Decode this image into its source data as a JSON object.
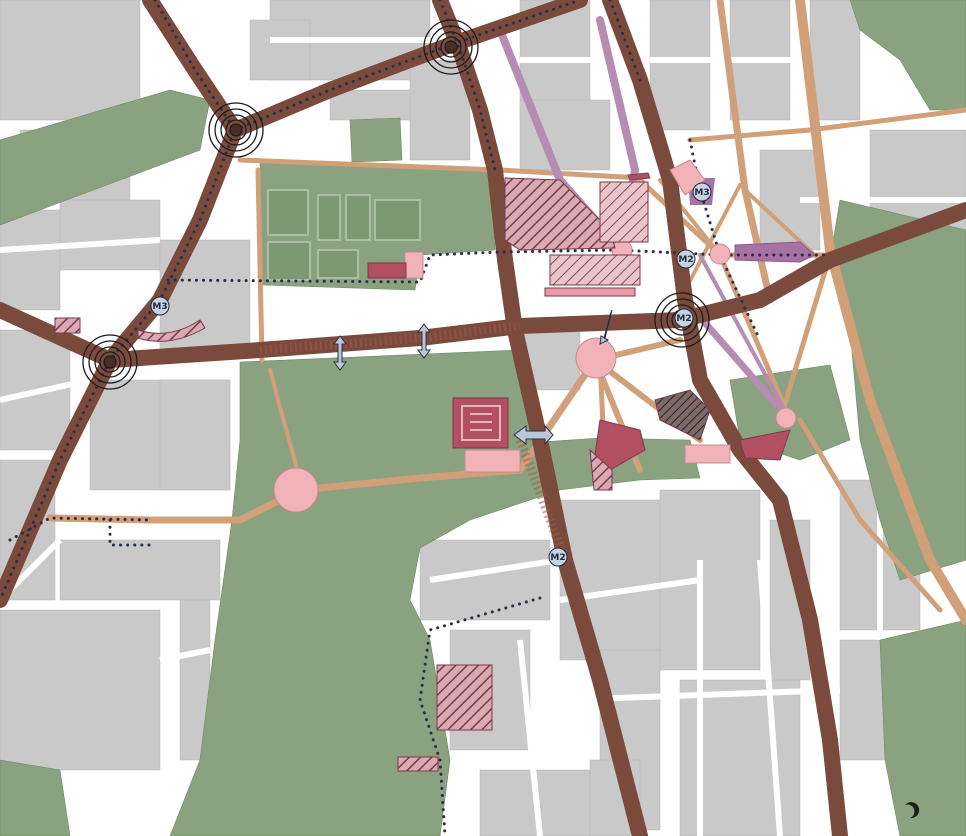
{
  "map": {
    "colors": {
      "park": "#8aa27f",
      "block": "#c9c9c9",
      "street": "#ffffff",
      "primary_road": "#7a4a3c",
      "secondary_road": "#d19f78",
      "pedestrian_axis": "#b58cb2",
      "plaza": "#f2b3b8",
      "project_site": "#b24f60",
      "metro_marker_fill": "#c7d3e3",
      "metro_line_dots": "#2b2f45"
    },
    "metro_stations": [
      {
        "id": "m3-west",
        "label": "M3"
      },
      {
        "id": "m3-north",
        "label": "M3"
      },
      {
        "id": "m2-star",
        "label": "M2"
      },
      {
        "id": "m2-node",
        "label": "M2"
      },
      {
        "id": "m2-south",
        "label": "M2"
      }
    ],
    "legend": null
  }
}
